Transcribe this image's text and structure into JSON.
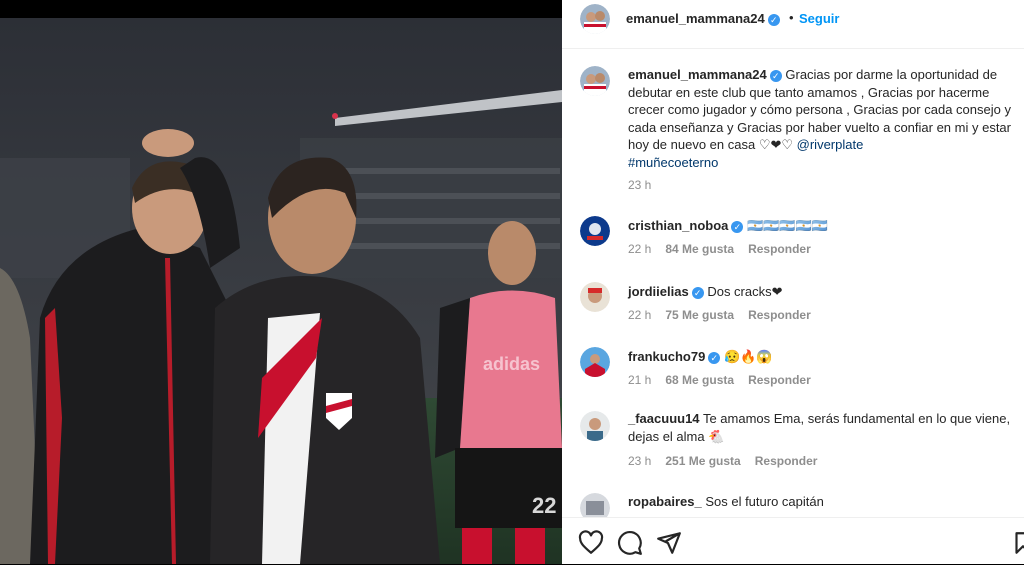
{
  "post": {
    "author": "emanuel_mammana24",
    "follow_label": "Seguir",
    "separator": "•",
    "caption": "Gracias por darme la oportunidad de debutar en este club que tanto amamos , Gracias por hacerme crecer como jugador y cómo persona , Gracias por cada consejo y cada enseñanza y Gracias por haber vuelto a confiar en mi y estar hoy de nuevo en casa ♡❤♡",
    "mention": "@riverplate",
    "hashtag": "#muñecoeterno",
    "time": "23 h"
  },
  "comments": [
    {
      "user": "cristhian_noboa",
      "verified": true,
      "text": "🇦🇷🇦🇷🇦🇷🇦🇷🇦🇷",
      "time": "22 h",
      "likes": "84 Me gusta",
      "reply": "Responder"
    },
    {
      "user": "jordiielias",
      "verified": true,
      "text": "Dos cracks❤",
      "time": "22 h",
      "likes": "75 Me gusta",
      "reply": "Responder"
    },
    {
      "user": "frankucho79",
      "verified": true,
      "text": "😥🔥😱",
      "time": "21 h",
      "likes": "68 Me gusta",
      "reply": "Responder"
    },
    {
      "user": "_faacuuu14",
      "verified": false,
      "text": "Te amamos Ema, serás fundamental en lo que viene, dejas el alma 🐔",
      "time": "23 h",
      "likes": "251 Me gusta",
      "reply": "Responder"
    },
    {
      "user": "ropabaires_",
      "verified": false,
      "text": "Sos el futuro capitán",
      "time": "",
      "likes": "",
      "reply": ""
    }
  ],
  "verified_glyph": "✓",
  "photo": {
    "bib_text": "adidas",
    "shirt_number": "22"
  },
  "icons": [
    "heart-icon",
    "comment-icon",
    "share-icon",
    "bookmark-icon"
  ],
  "colors": {
    "accent": "#0095f6",
    "verified": "#3897f0",
    "meta": "#8e8e8e"
  }
}
